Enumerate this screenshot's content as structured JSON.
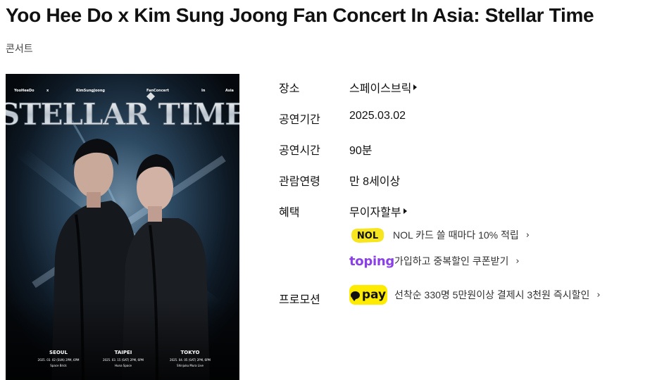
{
  "page": {
    "title": "Yoo Hee Do x Kim Sung Joong Fan Concert In Asia: Stellar Time",
    "category": "콘서트"
  },
  "poster": {
    "header_items": [
      "YooHeeDo",
      "x",
      "KimSungJoong",
      "FanConcert",
      "In",
      "Asia"
    ],
    "logo_text": "STELLAR TIME",
    "cities": [
      {
        "name": "SEOUL",
        "date": "2025. 03. 02 (SUN) 2PM, 6PM",
        "venue": "Space Brick"
      },
      {
        "name": "TAIPEI",
        "date": "2025. 03. 15 (SAT) 2PM, 6PM",
        "venue": "Huna Space"
      },
      {
        "name": "TOKYO",
        "date": "2025. 04. 05 (SAT) 2PM, 6PM",
        "venue": "Shinjuku Mura Live"
      }
    ]
  },
  "info": {
    "venue": {
      "label": "장소",
      "value": "스페이스브릭"
    },
    "period": {
      "label": "공연기간",
      "value": "2025.03.02"
    },
    "runtime": {
      "label": "공연시간",
      "value": "90분"
    },
    "age": {
      "label": "관람연령",
      "value": "만 8세이상"
    },
    "benefit": {
      "label": "혜택",
      "value": "무이자할부",
      "items": [
        {
          "logo": "nol-logo",
          "logo_text": "NOL",
          "text": "NOL 카드 쓸 때마다 10% 적립"
        },
        {
          "logo": "toping-logo",
          "logo_text": "toping",
          "text": "가입하고 중복할인 쿠폰받기"
        }
      ]
    },
    "promotion": {
      "label": "프로모션",
      "logo_text": "pay",
      "text": "선착순 330명 5만원이상 결제시 3천원 즉시할인"
    }
  },
  "colors": {
    "toping_purple": "#8a3fe8",
    "kakaopay_yellow": "#ffeb00",
    "nol_yellow": "#f6e51f"
  },
  "icons": {
    "chevron": "›"
  }
}
